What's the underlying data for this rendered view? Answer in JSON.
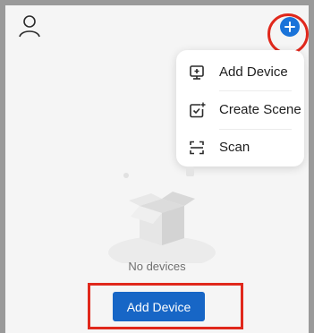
{
  "header": {
    "profile_icon": "person-icon",
    "add_icon": "plus-icon",
    "accent_color": "#1a73d9"
  },
  "add_menu": {
    "items": [
      {
        "label": "Add Device",
        "icon": "add-device-icon"
      },
      {
        "label": "Create Scene",
        "icon": "create-scene-icon"
      },
      {
        "label": "Scan",
        "icon": "scan-icon"
      }
    ]
  },
  "empty_state": {
    "illustration": "empty-box-illustration",
    "text": "No devices",
    "button_label": "Add Device",
    "button_color": "#1766c6"
  },
  "annotations": {
    "highlight_color": "#e0281c"
  }
}
